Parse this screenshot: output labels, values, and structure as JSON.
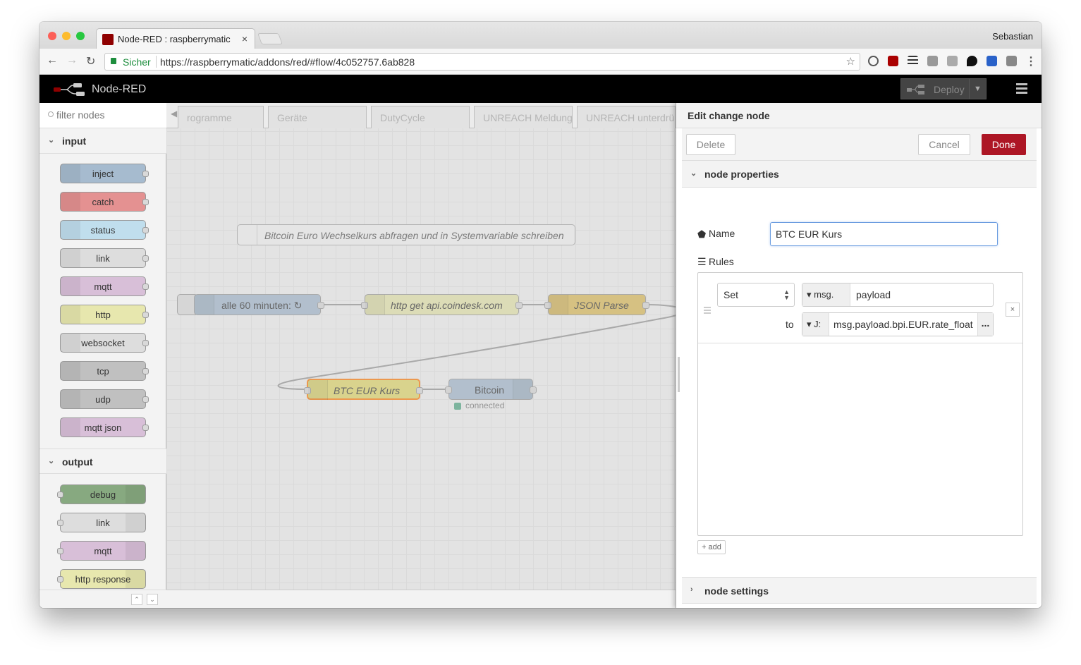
{
  "browser": {
    "tab_title": "Node-RED : raspberrymatic",
    "tab_close": "×",
    "user": "Sebastian",
    "security_label": "Sicher",
    "url": "https://raspberrymatic/addons/red/#flow/4c052757.6ab828"
  },
  "app": {
    "brand": "Node-RED",
    "deploy_label": "Deploy"
  },
  "palette": {
    "filter_placeholder": "filter nodes",
    "categories": [
      {
        "name": "input",
        "nodes": [
          "inject",
          "catch",
          "status",
          "link",
          "mqtt",
          "http",
          "websocket",
          "tcp",
          "udp",
          "mqtt json"
        ]
      },
      {
        "name": "output",
        "nodes": [
          "debug",
          "link",
          "mqtt",
          "http response"
        ]
      }
    ],
    "colors": {
      "inject": "#a6bbcf",
      "catch": "#e49191",
      "status": "#c0deed",
      "link": "#dddddd",
      "mqtt": "#d8bfd8",
      "http": "#e7e7ae",
      "websocket": "#dddddd",
      "tcp": "#c0c0c0",
      "udp": "#c0c0c0",
      "mqtt json": "#d8bfd8",
      "debug": "#87a980",
      "http response": "#e7e7ae"
    }
  },
  "workspace": {
    "tabs": [
      "rogramme",
      "Geräte",
      "DutyCycle",
      "UNREACH Meldung",
      "UNREACH unterdrü"
    ],
    "comment": "Bitcoin Euro Wechselkurs abfragen und in Systemvariable schreiben",
    "nodes": {
      "inject": "alle 60 minuten: ↻",
      "http": "http get api.coindesk.com",
      "json": "JSON Parse",
      "change": "BTC EUR Kurs",
      "ccu": "Bitcoin",
      "ccu_status": "connected"
    }
  },
  "editor": {
    "title": "Edit change node",
    "delete_label": "Delete",
    "cancel_label": "Cancel",
    "done_label": "Done",
    "properties_label": "node properties",
    "settings_label": "node settings",
    "name_label": "Name",
    "name_value": "BTC EUR Kurs",
    "rules_label": "Rules",
    "rule": {
      "action": "Set",
      "target_prefix": "msg.",
      "target_value": "payload",
      "to_label": "to",
      "source_type": "J:",
      "source_value": "msg.payload.bpi.EUR.rate_float",
      "more": "...",
      "remove": "×"
    },
    "add_label": "+ add"
  }
}
